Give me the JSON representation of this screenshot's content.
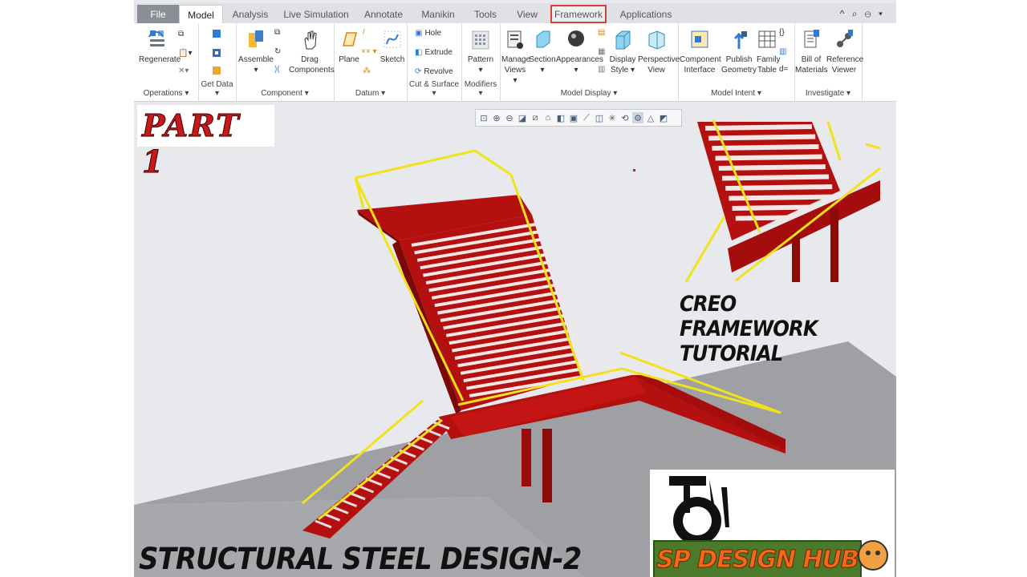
{
  "tabs": [
    {
      "label": "File"
    },
    {
      "label": "Model"
    },
    {
      "label": "Analysis"
    },
    {
      "label": "Live Simulation"
    },
    {
      "label": "Annotate"
    },
    {
      "label": "Manikin"
    },
    {
      "label": "Tools"
    },
    {
      "label": "View"
    },
    {
      "label": "Framework"
    },
    {
      "label": "Applications"
    }
  ],
  "window_controls": "^ ⌕ ⊖ ▾",
  "ribbon": {
    "operations": {
      "group": "Operations ▾",
      "regenerate": "Regenerate"
    },
    "get_data": {
      "group": "Get Data ▾"
    },
    "component": {
      "group": "Component ▾",
      "assemble": "Assemble",
      "drag": "Drag Components"
    },
    "datum": {
      "group": "Datum ▾",
      "plane": "Plane",
      "sketch": "Sketch"
    },
    "cut_surface": {
      "group": "Cut & Surface ▾",
      "hole": "Hole",
      "extrude": "Extrude",
      "revolve": "Revolve"
    },
    "modifiers": {
      "group": "Modifiers ▾",
      "pattern": "Pattern"
    },
    "model_display": {
      "group": "Model Display ▾",
      "manage_views": "Manage Views ▾",
      "section": "Section",
      "appearances": "Appearances",
      "display_style": "Display Style ▾",
      "perspective": "Perspective View"
    },
    "model_intent": {
      "group": "Model Intent ▾",
      "component_interface": "Component Interface",
      "publish_geometry": "Publish Geometry",
      "family_table": "Family Table"
    },
    "investigate": {
      "group": "Investigate ▾",
      "bom": "Bill of Materials",
      "reference_viewer": "Reference Viewer"
    }
  },
  "overlays": {
    "part": "PART 1",
    "creo_title": "CREO FRAMEWORK TUTORIAL",
    "bottom_title": "STRUCTURAL STEEL DESIGN-2",
    "logo_text": "SP DESIGN HUB"
  },
  "colors": {
    "steel": "#b3100f",
    "railing": "#f2e21b",
    "ground": "#9ea0a3",
    "background": "#e8e9ed",
    "accent": "#d9403b"
  }
}
